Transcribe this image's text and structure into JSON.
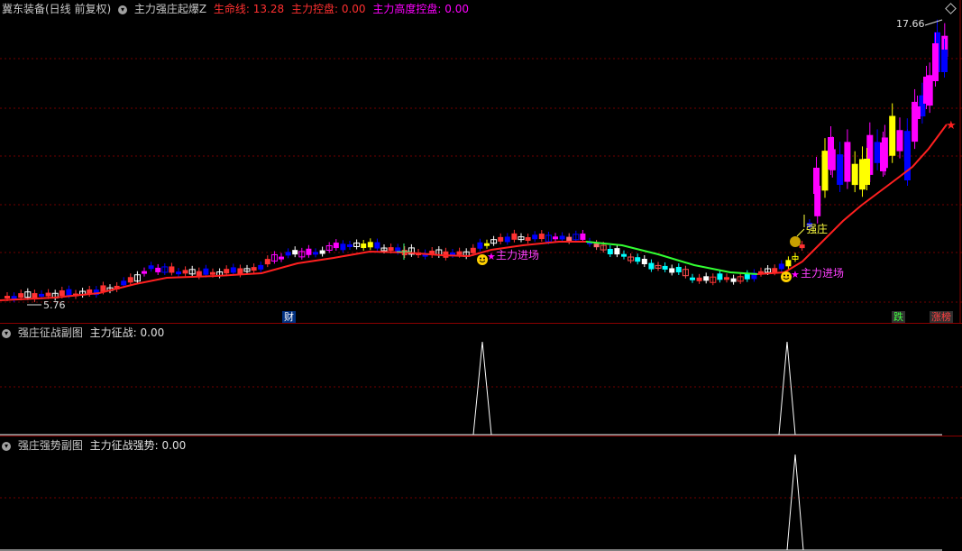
{
  "main_header": {
    "stock": "冀东装备(日线 前复权)",
    "indicator": "主力强庄起爆Z",
    "line_label": "生命线:",
    "line_value": "13.28",
    "ctrl_label": "主力控盘:",
    "ctrl_value": "0.00",
    "high_ctrl_label": "主力高度控盘:",
    "high_ctrl_value": "0.00"
  },
  "main_chart": {
    "high_price": "17.66",
    "low_price": "5.76",
    "entry_label_1": "主力进场",
    "entry_label_2": "主力进场",
    "strong_label": "强庄",
    "cai_tag": "财",
    "die_tag": "跌",
    "zhang_tag": "涨榜"
  },
  "sub1": {
    "title": "强庄征战副图",
    "series_label": "主力征战:",
    "series_value": "0.00"
  },
  "sub2": {
    "title": "强庄强势副图",
    "series_label": "主力征战强势:",
    "series_value": "0.00"
  },
  "colors": {
    "up": "#ff3232",
    "magenta": "#ff00ff",
    "blue": "#0000ff",
    "yellow": "#ffff00",
    "cyan": "#00ffff",
    "green_line": "#32ff32",
    "red_line": "#ff2020",
    "grid": "#700000"
  },
  "chart_data": {
    "type": "candlestick",
    "symbol": "冀东装备",
    "y_high_label": 17.66,
    "y_low_label": 5.76,
    "life_line_value": 13.28,
    "sub_indicators": [
      {
        "name": "主力征战",
        "value": 0.0,
        "spikes": 2
      },
      {
        "name": "主力征战强势",
        "value": 0.0,
        "spikes": 1
      }
    ]
  }
}
